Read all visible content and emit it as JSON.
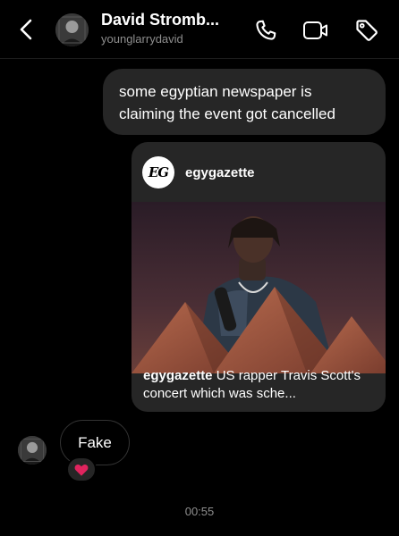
{
  "header": {
    "title": "David Stromb...",
    "subtitle": "younglarrydavid",
    "icons": [
      "back-icon",
      "phone-icon",
      "video-camera-icon",
      "tag-icon"
    ]
  },
  "messages": {
    "outgoing_text": "some egyptian newspaper is claiming the event got cancelled",
    "shared_post": {
      "logo_text": "EG",
      "username": "egygazette",
      "caption_user": "egygazette",
      "caption_text": "US rapper Travis Scott's concert which was sche..."
    },
    "incoming_text": "Fake",
    "reaction": "❤️"
  },
  "timestamp": "00:55",
  "colors": {
    "background": "#000000",
    "bubble": "#262626",
    "secondary_text": "#8e8e8e",
    "reaction_heart": "#e0245e"
  }
}
